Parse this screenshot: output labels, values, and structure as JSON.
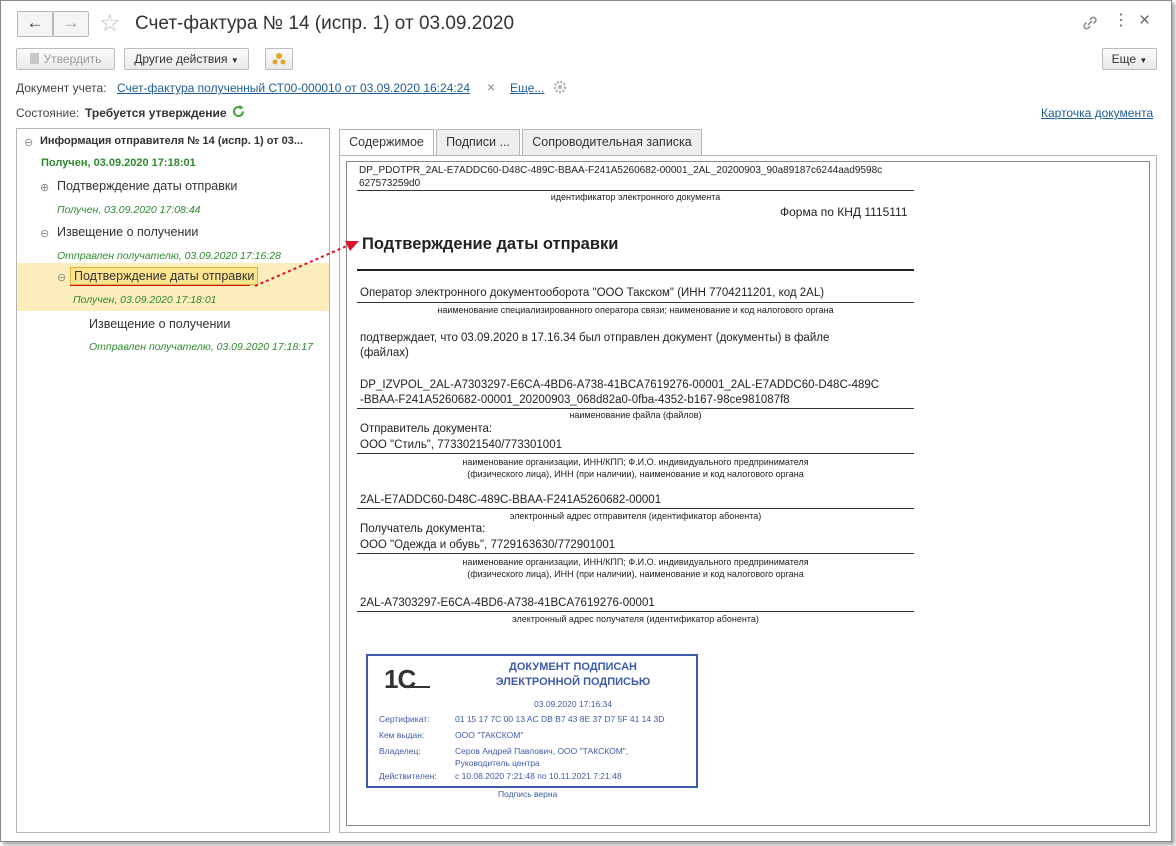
{
  "window": {
    "title": "Счет-фактура № 14 (испр. 1) от 03.09.2020"
  },
  "toolbar": {
    "approve_label": "Утвердить",
    "other_actions_label": "Другие действия",
    "more_label": "Еще"
  },
  "account_doc": {
    "label": "Документ учета:",
    "link": "Счет-фактура полученный СТ00-000010 от 03.09.2020 16:24:24",
    "more": "Еще..."
  },
  "state": {
    "label": "Состояние:",
    "value": "Требуется утверждение"
  },
  "card_link": "Карточка документа",
  "tree": {
    "root": {
      "title": "Информация отправителя № 14 (испр. 1) от 03...",
      "status": "Получен, 03.09.2020 17:18:01"
    },
    "items": [
      {
        "title": "Подтверждение даты отправки",
        "status": "Получен, 03.09.2020 17:08:44"
      },
      {
        "title": "Извещение о получении",
        "status": "Отправлен получателю, 03.09.2020 17:16:28"
      },
      {
        "title": "Подтверждение даты отправки",
        "status": "Получен, 03.09.2020 17:18:01"
      },
      {
        "title": "Извещение о получении",
        "status": "Отправлен получателю, 03.09.2020 17:18:17"
      }
    ]
  },
  "tabs": [
    "Содержимое",
    "Подписи ...",
    "Сопроводительная записка"
  ],
  "doc": {
    "file_id_line1": "DP_PDOTPR_2AL-E7ADDC60-D48C-489C-BBAA-F241A5260682-00001_2AL_20200903_90a89187c6244aad9598c",
    "file_id_line2": "627573259d0",
    "file_id_caption": "идентификатор электронного документа",
    "form": "Форма по КНД 1115111",
    "heading": "Подтверждение даты отправки",
    "operator": "Оператор электронного документооборота \"ООО Такском\" (ИНН 7704211201, код 2AL)",
    "operator_caption": "наименование специализированного оператора связи; наименование и код налогового органа",
    "confirms_1": "подтверждает, что 03.09.2020 в 17.16.34 был отправлен документ  (документы) в файле",
    "confirms_2": "(файлах)",
    "file_name_1": "DP_IZVPOL_2AL-A7303297-E6CA-4BD6-A738-41BCA7619276-00001_2AL-E7ADDC60-D48C-489C",
    "file_name_2": "-BBAA-F241A5260682-00001_20200903_068d82a0-0fba-4352-b167-98ce981087f8",
    "file_name_caption": "наименование файла (файлов)",
    "sender_label": "Отправитель документа:",
    "sender_value": "ООО \"Стиль\", 7733021540/773301001",
    "org_caption_1": "наименование организации, ИНН/КПП; Ф.И.О. индивидуального предпринимателя",
    "org_caption_2": "(физического лица), ИНН (при наличии), наименование и код налогового органа",
    "sender_addr": "2AL-E7ADDC60-D48C-489C-BBAA-F241A5260682-00001",
    "sender_addr_caption": "электронный адрес отправителя (идентификатор абонента)",
    "receiver_label": "Получатель документа:",
    "receiver_value": "ООО \"Одежда и обувь\", 7729163630/772901001",
    "receiver_addr": "2AL-A7303297-E6CA-4BD6-A738-41BCA7619276-00001",
    "receiver_addr_caption": "электронный адрес получателя (идентификатор абонента)"
  },
  "stamp": {
    "logo": "1С",
    "title_1": "ДОКУМЕНТ ПОДПИСАН",
    "title_2": "ЭЛЕКТРОННОЙ ПОДПИСЬЮ",
    "date": "03.09.2020 17:16:34",
    "cert_label": "Сертификат:",
    "cert_value": "01 15 17 7C 00 13 AC DB B7 43 8E 37 D7 5F 41 14 3D",
    "issuer_label": "Кем выдан:",
    "issuer_value": "ООО \"ТАКСКОМ\"",
    "owner_label": "Владелец:",
    "owner_value_1": "Серов Андрей Павлович, ООО \"ТАКСКОМ\",",
    "owner_value_2": "Руководитель центра",
    "valid_label": "Действителен:",
    "valid_value": "с 10.08.2020 7:21:48 по 10.11.2021 7:21:48",
    "verified": "Подпись верна"
  },
  "colors": {
    "link": "#1f5d97",
    "status_green": "#2f8a2f",
    "stamp_blue": "#3e5ba7",
    "highlight": "#fbeebc",
    "arrow_red": "#e0102a"
  }
}
